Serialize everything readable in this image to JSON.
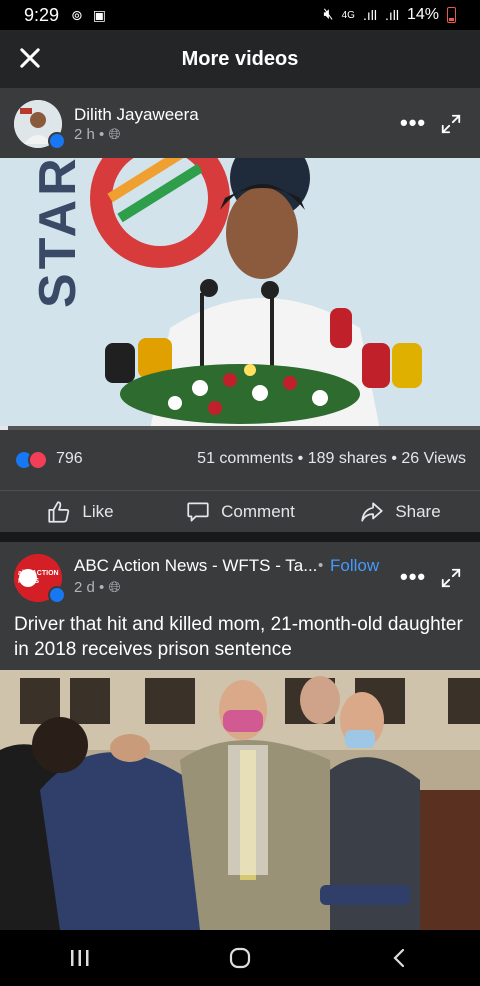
{
  "status": {
    "time": "9:29",
    "net_type": "4G",
    "battery": "14%"
  },
  "header": {
    "title": "More videos"
  },
  "posts": [
    {
      "author": "Dilith Jayaweera",
      "time": "2 h",
      "reactions_count": "796",
      "stats": "51 comments • 189 shares • 26 Views",
      "actions": {
        "like": "Like",
        "comment": "Comment",
        "share": "Share"
      },
      "video_text": "STAR"
    },
    {
      "author": "ABC Action News - WFTS - Ta...",
      "follow": "Follow",
      "time": "2 d",
      "avatar_text": "abc ACTION NEWS",
      "headline": "Driver that hit and killed mom, 21-month-old daughter in 2018 receives prison sentence"
    }
  ],
  "icons": {
    "close": "close-icon",
    "more": "more-icon",
    "expand": "expand-icon",
    "globe": "globe-icon",
    "like": "thumbs-up-icon",
    "comment": "comment-icon",
    "share": "share-icon"
  },
  "colors": {
    "background": "#242526",
    "card": "#3a3b3c",
    "link": "#4599ff",
    "like_blue": "#1877f2",
    "love_red": "#f33e58"
  }
}
